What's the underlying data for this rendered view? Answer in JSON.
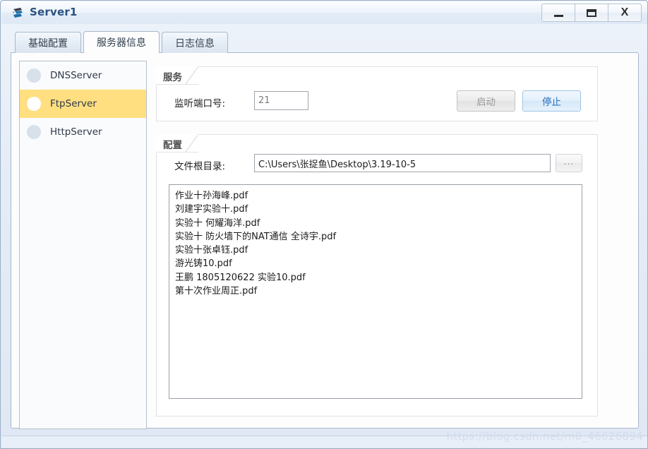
{
  "window": {
    "title": "Server1",
    "icon": "app-icon",
    "controls": {
      "minimize": "–",
      "maximize": "□",
      "close": "X"
    }
  },
  "tabs": [
    {
      "label": "基础配置",
      "active": false
    },
    {
      "label": "服务器信息",
      "active": true
    },
    {
      "label": "日志信息",
      "active": false
    }
  ],
  "sidebar": {
    "items": [
      {
        "label": "DNSServer",
        "selected": false
      },
      {
        "label": "FtpServer",
        "selected": true
      },
      {
        "label": "HttpServer",
        "selected": false
      }
    ]
  },
  "service_group": {
    "title": "服务",
    "port_label": "监听端口号:",
    "port_value": "21",
    "start_button": "启动",
    "stop_button": "停止"
  },
  "config_group": {
    "title": "配置",
    "root_dir_label": "文件根目录:",
    "root_dir_value": "C:\\Users\\张捉鱼\\Desktop\\3.19-10-5",
    "browse_button": "...",
    "files": [
      "作业十孙海峰.pdf",
      "刘建宇实验十.pdf",
      "实验十 何耀海洋.pdf",
      "实验十 防火墙下的NAT通信 全诗宇.pdf",
      "实验十张卓钰.pdf",
      "游光铸10.pdf",
      "王鹏 1805120622 实验10.pdf",
      "第十次作业周正.pdf"
    ]
  },
  "watermark": "https://blog.csdn.net/m0_46626894",
  "colors": {
    "selection_yellow": "#ffdf80",
    "title_blue": "#2a5180",
    "highlight_button_blue": "#2a6fba"
  }
}
